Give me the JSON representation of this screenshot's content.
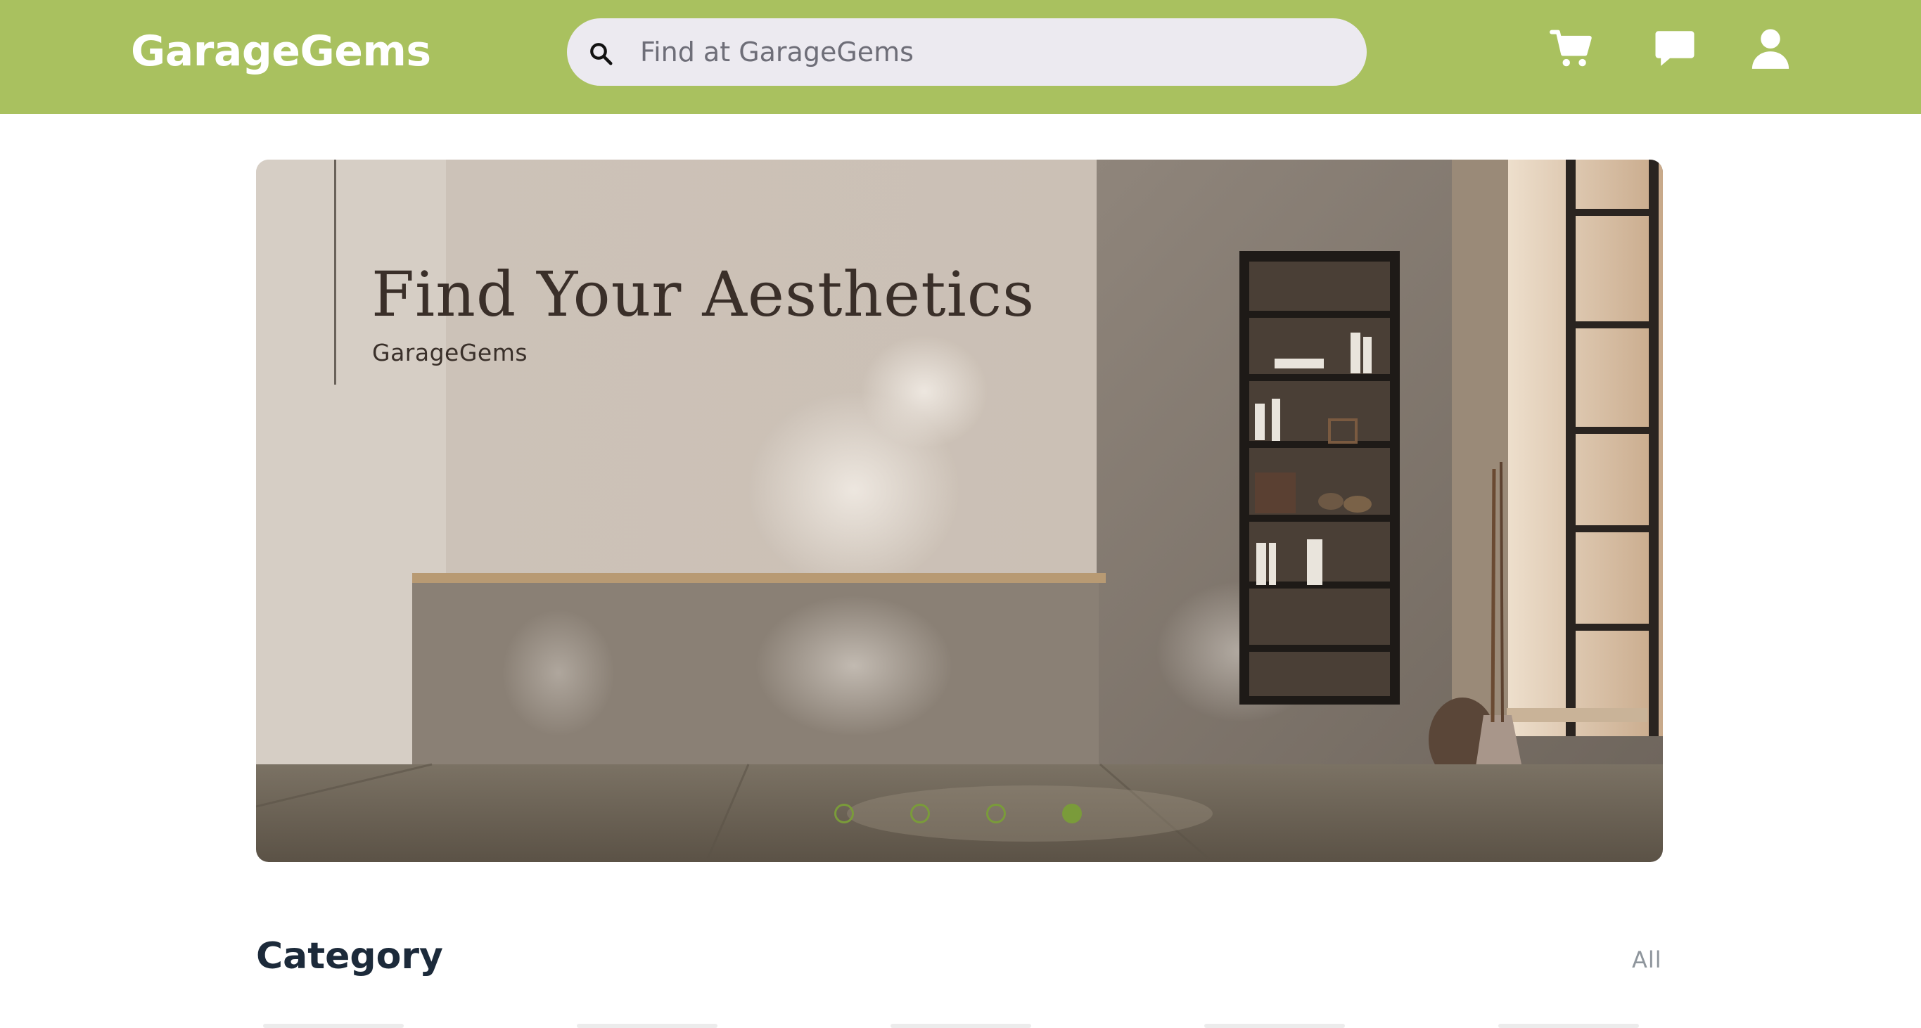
{
  "header": {
    "logo": "GarageGems",
    "search_placeholder": "Find at GarageGems",
    "icons": [
      "search-icon",
      "cart-icon",
      "chat-icon",
      "user-icon"
    ]
  },
  "hero": {
    "title": "Find Your Aesthetics",
    "subtitle": "GarageGems",
    "slides_total": 4,
    "active_slide": 4
  },
  "category": {
    "title": "Category",
    "all_link": "All"
  },
  "colors": {
    "brand": "#a9c15f",
    "accent_dot": "#7a9b3a",
    "search_bg": "#eceaf0"
  }
}
